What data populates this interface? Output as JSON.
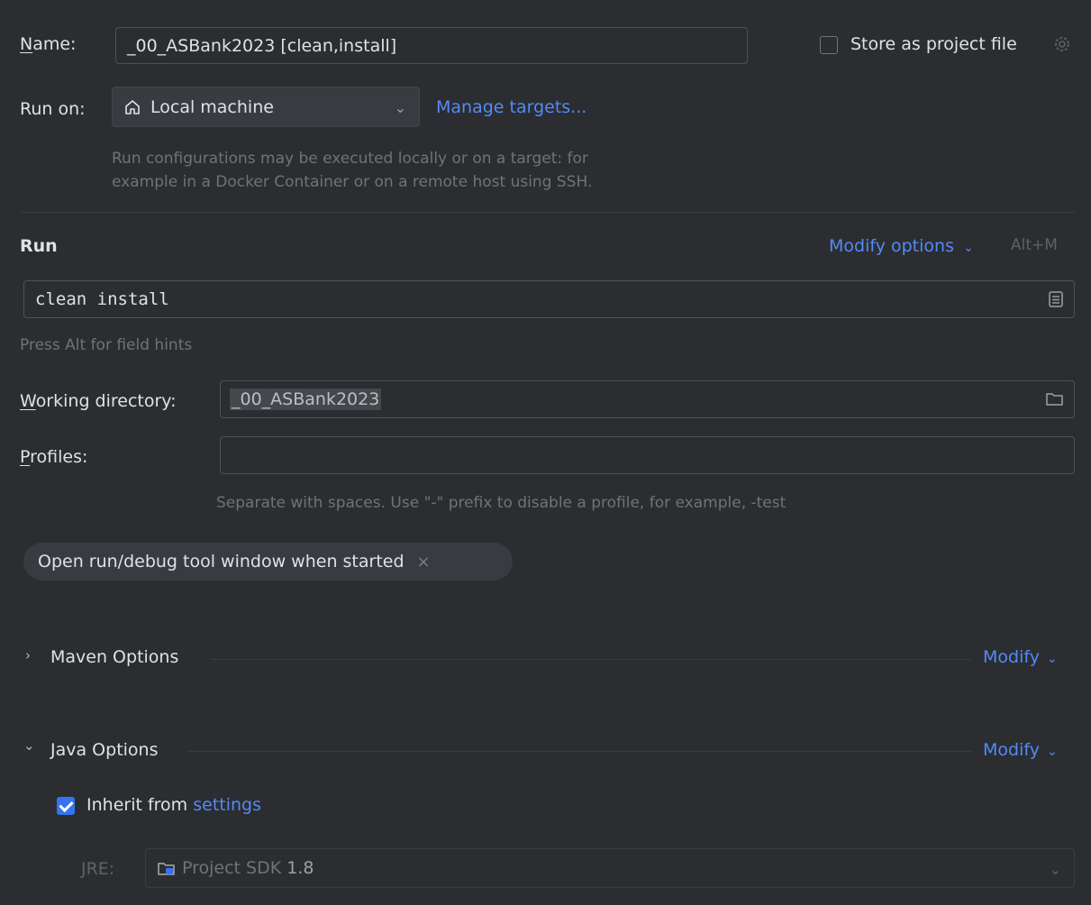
{
  "name": {
    "label_first": "N",
    "label_rest": "ame:",
    "value": "_00_ASBank2023 [clean,install]"
  },
  "store_as_project": {
    "label": "Store as project file",
    "checked": false
  },
  "run_on": {
    "label": "Run on:",
    "selected": "Local machine",
    "manage_link": "Manage targets...",
    "hint_line1": "Run configurations may be executed locally or on a target: for",
    "hint_line2": "example in a Docker Container or on a remote host using SSH."
  },
  "run_section": {
    "title": "Run",
    "modify_options": "Modify options",
    "shortcut": "Alt+M",
    "command": "clean install",
    "field_hint": "Press Alt for field hints"
  },
  "working_directory": {
    "label_first": "W",
    "label_rest": "orking directory:",
    "value": "_00_ASBank2023"
  },
  "profiles": {
    "label_first": "P",
    "label_rest": "rofiles:",
    "value": "",
    "hint": "Separate with spaces. Use \"-\" prefix to disable a profile, for example, -test"
  },
  "chip": {
    "label": "Open run/debug tool window when started"
  },
  "maven_options": {
    "title": "Maven Options",
    "modify": "Modify"
  },
  "java_options": {
    "title": "Java Options",
    "modify": "Modify",
    "inherit_label": "Inherit from",
    "inherit_link": "settings",
    "inherit_checked": true,
    "jre_label": "JRE:",
    "jre_prefix": "Project SDK",
    "jre_version": "1.8"
  }
}
